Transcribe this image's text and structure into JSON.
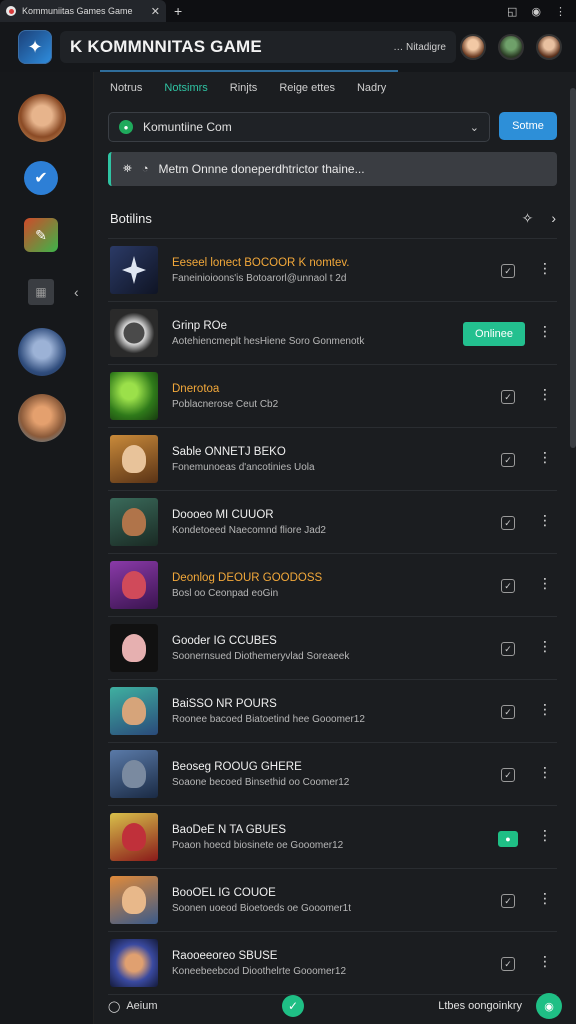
{
  "browser": {
    "tab_title": "Kommuniitas Games Game",
    "tab_close": "✕",
    "new_tab": "+"
  },
  "header": {
    "title": "K KOMMNNITAS GAME",
    "right_label": "… Nitadigre"
  },
  "tabs": [
    {
      "label": "Notrus"
    },
    {
      "label": "Notsimrs"
    },
    {
      "label": "Rinjts"
    },
    {
      "label": "Reige ettes"
    },
    {
      "label": "Nadry"
    }
  ],
  "filter": {
    "select_value": "Komuntiine Com",
    "button_label": "Sotme",
    "search_placeholder": "Metm Onnne doneperdhtrictor thaine..."
  },
  "section": {
    "title": "Botilins"
  },
  "rows": [
    {
      "name": "Eeseel lonect BOCOOR K nomtev.",
      "sub": "Faneinioioons'is Botoarorl@unnaol t 2d"
    },
    {
      "name": "Grinp ROe",
      "sub": "Aotehiencmeplt hesHiene Soro Gonmenotk",
      "status": "Onlinee"
    },
    {
      "name": "Dnerotoa",
      "sub": "Poblacnerose Ceut Cb2"
    },
    {
      "name": "Sable ONNETJ BEKO",
      "sub": "Fonemunoeas d'ancotinies Uola"
    },
    {
      "name": "Doooeo MI CUUOR",
      "sub": "Kondetoeed Naecomnd fliore Jad2"
    },
    {
      "name": "Deonlog DEOUR GOODOSS",
      "sub": "Bosl oo Ceonpad eoGin"
    },
    {
      "name": "Gooder IG CCUBES",
      "sub": "Soonernsued Diothemeryvlad Soreaeek"
    },
    {
      "name": "BaiSSO NR POURS",
      "sub": "Roonee bacoed Biatoetind hee Gooomer12"
    },
    {
      "name": "Beoseg ROOUG GHERE",
      "sub": "Soaone becoed Binsethid oo Coomer12"
    },
    {
      "name": "BaoDeE N TA GBUES",
      "sub": "Poaon hoecd biosinete oe Gooomer12"
    },
    {
      "name": "BooOEL IG COUOE",
      "sub": "Soonen uoeod Bioetoeds oe Gooomer1t"
    },
    {
      "name": "Raooeeoreo SBUSE",
      "sub": "Koneebeebcod Dioothelrte Gooomer12"
    }
  ],
  "footer": {
    "left_label": "Aeium",
    "right_label": "Ltbes oongoinkry"
  },
  "colors": {
    "accent_teal": "#2fc4a3",
    "primary_blue": "#2d8fd8",
    "online_green": "#23c08f"
  }
}
